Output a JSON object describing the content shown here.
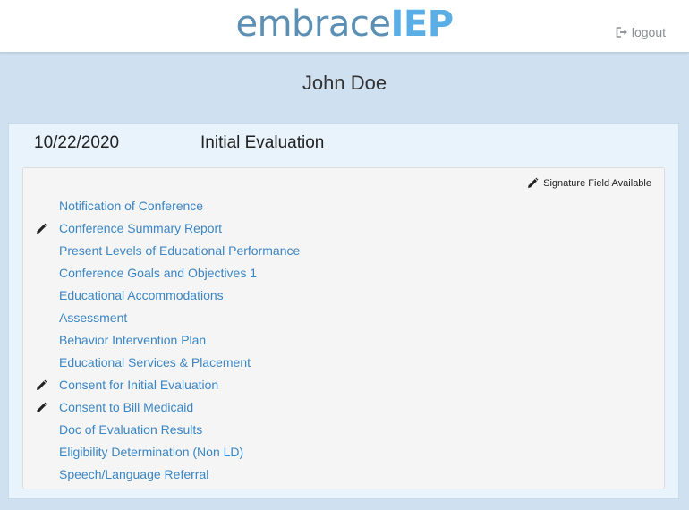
{
  "header": {
    "logo_part1": "embrace",
    "logo_part2": "IEP",
    "logout_label": "logout"
  },
  "patient": {
    "name": "John Doe"
  },
  "evaluation": {
    "date": "10/22/2020",
    "title": "Initial Evaluation",
    "legend_label": "Signature Field Available",
    "documents": [
      {
        "label": "Notification of Conference",
        "signature": false
      },
      {
        "label": "Conference Summary Report",
        "signature": true
      },
      {
        "label": "Present Levels of Educational Performance",
        "signature": false
      },
      {
        "label": "Conference Goals and Objectives 1",
        "signature": false
      },
      {
        "label": "Educational Accommodations",
        "signature": false
      },
      {
        "label": "Assessment",
        "signature": false
      },
      {
        "label": "Behavior Intervention Plan",
        "signature": false
      },
      {
        "label": "Educational Services & Placement",
        "signature": false
      },
      {
        "label": "Consent for Initial Evaluation",
        "signature": true
      },
      {
        "label": "Consent to Bill Medicaid",
        "signature": true
      },
      {
        "label": "Doc of Evaluation Results",
        "signature": false
      },
      {
        "label": "Eligibility Determination (Non LD)",
        "signature": false
      },
      {
        "label": "Speech/Language Referral",
        "signature": false
      }
    ]
  },
  "colors": {
    "link": "#3a86c4",
    "logo_primary": "#5b8fb3",
    "logo_accent": "#5aaee6",
    "page_bg": "#cfe0f1"
  },
  "icons": {
    "logout": "logout-icon",
    "signature": "pencil-icon"
  }
}
